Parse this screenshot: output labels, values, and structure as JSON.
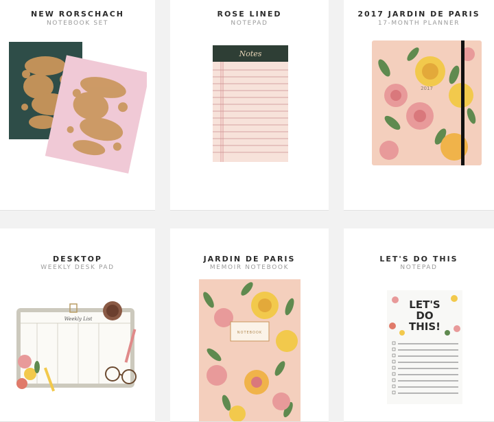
{
  "products": [
    {
      "title": "NEW RORSCHACH",
      "subtitle": "NOTEBOOK SET"
    },
    {
      "title": "ROSE LINED",
      "subtitle": "NOTEPAD"
    },
    {
      "title": "2017 JARDIN DE PARIS",
      "subtitle": "17-MONTH PLANNER"
    },
    {
      "title": "DESKTOP",
      "subtitle": "WEEKLY DESK PAD"
    },
    {
      "title": "JARDIN DE PARIS",
      "subtitle": "MEMOIR NOTEBOOK"
    },
    {
      "title": "LET'S DO THIS",
      "subtitle": "NOTEPAD"
    }
  ],
  "artwork_text": {
    "notes_script": "Notes",
    "planner_year": "2017",
    "weekly_script": "Weekly List",
    "memoir_label": "NOTEBOOK",
    "lets_do_this_lines": [
      "LET'S",
      "DO",
      "THIS!"
    ]
  },
  "colors": {
    "page_bg": "#f2f2f2",
    "card_bg": "#ffffff",
    "dark_green": "#2e4d48",
    "gold": "#c9955a",
    "blush_pink": "#f0c9d6",
    "peach": "#f4cfbd",
    "rose": "#e8a0a0",
    "yellow": "#f2c94c",
    "leaf_green": "#5f8a4f"
  }
}
